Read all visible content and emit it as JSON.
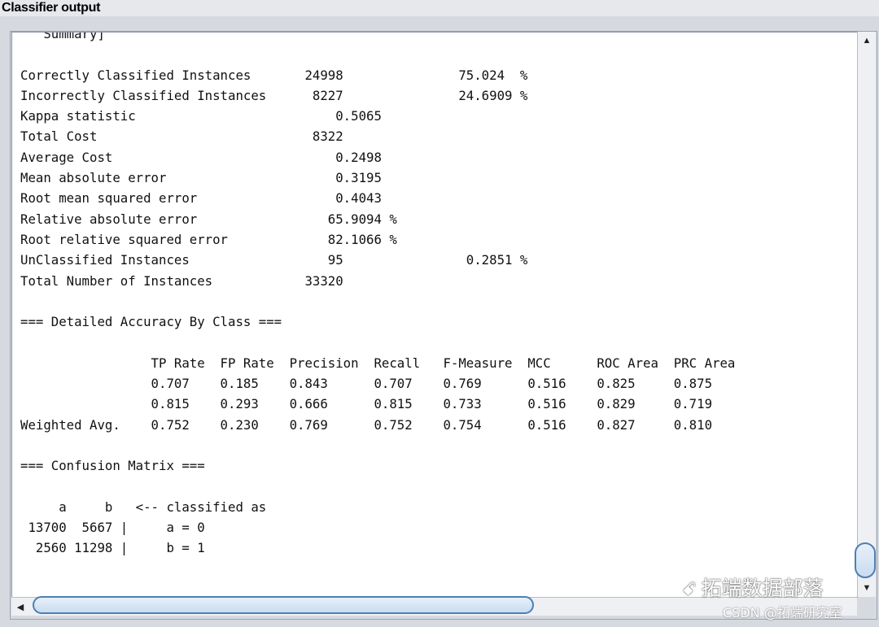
{
  "panel": {
    "title": "Classifier output"
  },
  "output": {
    "lines": [
      "   Summary]",
      "",
      "Correctly Classified Instances       24998               75.024  %",
      "Incorrectly Classified Instances      8227               24.6909 %",
      "Kappa statistic                          0.5065",
      "Total Cost                            8322",
      "Average Cost                             0.2498",
      "Mean absolute error                      0.3195",
      "Root mean squared error                  0.4043",
      "Relative absolute error                 65.9094 %",
      "Root relative squared error             82.1066 %",
      "UnClassified Instances                  95                0.2851 %",
      "Total Number of Instances            33320",
      "",
      "=== Detailed Accuracy By Class ===",
      "",
      "                 TP Rate  FP Rate  Precision  Recall   F-Measure  MCC      ROC Area  PRC Area",
      "                 0.707    0.185    0.843      0.707    0.769      0.516    0.825     0.875",
      "                 0.815    0.293    0.666      0.815    0.733      0.516    0.829     0.719",
      "Weighted Avg.    0.752    0.230    0.769      0.752    0.754      0.516    0.827     0.810",
      "",
      "=== Confusion Matrix ===",
      "",
      "     a     b   <-- classified as",
      " 13700  5667 |     a = 0",
      "  2560 11298 |     b = 1"
    ]
  },
  "scrollbars": {
    "vertical": {
      "up_icon": "arrow-up-icon",
      "down_icon": "arrow-down-icon"
    },
    "horizontal": {
      "left_icon": "arrow-left-icon"
    }
  },
  "watermark": {
    "brand": "拓端数据部落",
    "icon": "wechat-icon",
    "credit": "CSDN @拓端研究室"
  }
}
